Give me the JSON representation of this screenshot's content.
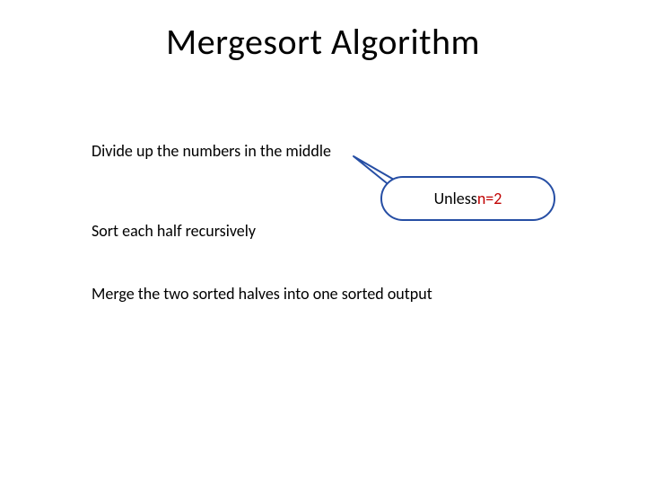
{
  "title": "Mergesort Algorithm",
  "steps": {
    "s1": "Divide up the numbers in the middle",
    "s2": "Sort each half recursively",
    "s3": "Merge the two sorted halves into one sorted output"
  },
  "callout": {
    "prefix": "Unless ",
    "highlight": "n=2"
  },
  "colors": {
    "border": "#264ea4",
    "accent": "#c00000"
  }
}
